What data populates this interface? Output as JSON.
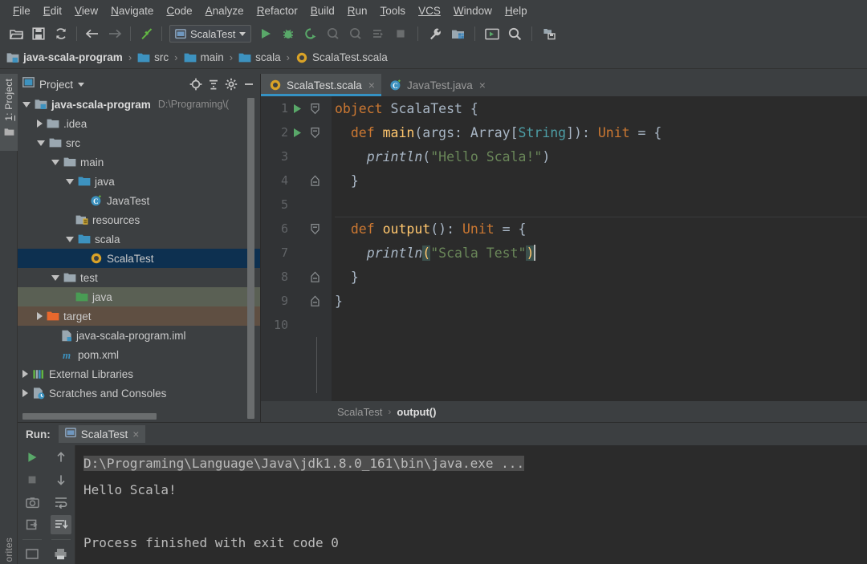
{
  "menubar": {
    "items": [
      {
        "pre": "F",
        "rest": "ile"
      },
      {
        "pre": "E",
        "rest": "dit"
      },
      {
        "pre": "V",
        "rest": "iew"
      },
      {
        "pre": "N",
        "rest": "avigate"
      },
      {
        "pre": "C",
        "rest": "ode"
      },
      {
        "pre": "A",
        "rest": "nalyze"
      },
      {
        "pre": "R",
        "rest": "efactor"
      },
      {
        "pre": "B",
        "rest": "uild"
      },
      {
        "pre": "R",
        "rest": "un"
      },
      {
        "pre": "T",
        "rest": "ools"
      },
      {
        "pre": "VCS",
        "rest": ""
      },
      {
        "pre": "W",
        "rest": "indow"
      },
      {
        "pre": "H",
        "rest": "elp"
      }
    ]
  },
  "toolbar": {
    "icons": [
      "open-folder-icon",
      "save-all-icon",
      "sync-icon",
      "back-arrow-icon",
      "forward-arrow-icon",
      "build-hammer-icon"
    ],
    "run_config": {
      "label": "ScalaTest",
      "icon": "run-config-icon"
    },
    "action_icons": [
      "run-icon",
      "debug-icon",
      "run-with-coverage-icon",
      "profile-icon",
      "profile-alt-icon",
      "rerun-icon",
      "stop-icon",
      "settings-wrench-icon",
      "project-structure-icon",
      "terminal-icon",
      "search-everywhere-icon",
      "update-project-icon"
    ]
  },
  "breadcrumb": {
    "items": [
      {
        "label": "java-scala-program",
        "icon": "module-icon",
        "bold": true
      },
      {
        "label": "src",
        "icon": "folder-icon",
        "bold": false
      },
      {
        "label": "main",
        "icon": "folder-icon",
        "bold": false
      },
      {
        "label": "scala",
        "icon": "folder-icon",
        "bold": false
      },
      {
        "label": "ScalaTest.scala",
        "icon": "scala-object-icon",
        "bold": false
      }
    ],
    "separator": "›"
  },
  "leftbar": {
    "project_tab": {
      "pre": "1",
      "rest": ": Project",
      "icon": "project-tool-icon"
    },
    "favorites_tab": {
      "label": "orites"
    }
  },
  "project_panel": {
    "title": "Project",
    "title_caret": "chevron-down-icon",
    "actions": [
      "locate-target-icon",
      "collapse-all-icon",
      "settings-gear-icon",
      "hide-panel-icon"
    ],
    "tree": [
      {
        "indent": 0,
        "arrow": "down",
        "icon": "module-icon",
        "label": "java-scala-program",
        "bold": true,
        "path": "D:\\Programing\\(",
        "state": "normal"
      },
      {
        "indent": 1,
        "arrow": "right",
        "icon": "folder-icon-gray",
        "label": ".idea",
        "bold": false,
        "path": "",
        "state": "normal"
      },
      {
        "indent": 1,
        "arrow": "down",
        "icon": "folder-icon-gray",
        "label": "src",
        "bold": false,
        "path": "",
        "state": "normal"
      },
      {
        "indent": 2,
        "arrow": "down",
        "icon": "folder-icon-gray",
        "label": "main",
        "bold": false,
        "path": "",
        "state": "normal"
      },
      {
        "indent": 3,
        "arrow": "down",
        "icon": "folder-icon-blue",
        "label": "java",
        "bold": false,
        "path": "",
        "state": "normal"
      },
      {
        "indent": 4,
        "arrow": "none",
        "icon": "java-class-icon",
        "label": "JavaTest",
        "bold": false,
        "path": "",
        "state": "normal"
      },
      {
        "indent": 3,
        "arrow": "none",
        "icon": "resources-icon",
        "label": "resources",
        "bold": false,
        "path": "",
        "state": "normal"
      },
      {
        "indent": 3,
        "arrow": "down",
        "icon": "folder-icon-blue",
        "label": "scala",
        "bold": false,
        "path": "",
        "state": "normal"
      },
      {
        "indent": 4,
        "arrow": "none",
        "icon": "scala-object-icon",
        "label": "ScalaTest",
        "bold": false,
        "path": "",
        "state": "selected"
      },
      {
        "indent": 2,
        "arrow": "down",
        "icon": "folder-icon-gray",
        "label": "test",
        "bold": false,
        "path": "",
        "state": "normal"
      },
      {
        "indent": 3,
        "arrow": "none",
        "icon": "folder-icon-green",
        "label": "java",
        "bold": false,
        "path": "",
        "state": "test-source"
      },
      {
        "indent": 1,
        "arrow": "right",
        "icon": "folder-icon-orange",
        "label": "target",
        "bold": false,
        "path": "",
        "state": "excluded"
      },
      {
        "indent": 2,
        "arrow": "none",
        "icon": "iml-file-icon",
        "label": "java-scala-program.iml",
        "bold": false,
        "path": "",
        "state": "normal"
      },
      {
        "indent": 2,
        "arrow": "none",
        "icon": "maven-pom-icon",
        "label": "pom.xml",
        "bold": false,
        "path": "",
        "state": "normal"
      },
      {
        "indent": 0,
        "arrow": "right",
        "icon": "libraries-icon",
        "label": "External Libraries",
        "bold": false,
        "path": "",
        "state": "normal"
      },
      {
        "indent": 0,
        "arrow": "right",
        "icon": "scratches-icon",
        "label": "Scratches and Consoles",
        "bold": false,
        "path": "",
        "state": "normal"
      }
    ]
  },
  "editor": {
    "tabs": [
      {
        "label": "ScalaTest.scala",
        "icon": "scala-object-icon",
        "active": true,
        "close": "×"
      },
      {
        "label": "JavaTest.java",
        "icon": "java-class-icon",
        "active": false,
        "close": "×"
      }
    ],
    "lines": [
      {
        "no": "1",
        "run": true,
        "fold": "open",
        "sep": false
      },
      {
        "no": "2",
        "run": true,
        "fold": "open",
        "sep": false
      },
      {
        "no": "3",
        "run": false,
        "fold": "none",
        "sep": false
      },
      {
        "no": "4",
        "run": false,
        "fold": "close",
        "sep": false
      },
      {
        "no": "5",
        "run": false,
        "fold": "none",
        "sep": false
      },
      {
        "no": "6",
        "run": false,
        "fold": "open",
        "sep": true
      },
      {
        "no": "7",
        "run": false,
        "fold": "none",
        "sep": false
      },
      {
        "no": "8",
        "run": false,
        "fold": "close",
        "sep": false
      },
      {
        "no": "9",
        "run": false,
        "fold": "close",
        "sep": false
      },
      {
        "no": "10",
        "run": false,
        "fold": "none",
        "sep": false
      }
    ],
    "code": {
      "l1_kw": "object",
      "l1_name": " ScalaTest ",
      "l1_brace": "{",
      "l2_kw": "def",
      "l2_name": " main",
      "l2_p1": "(args: ",
      "l2_t1": "Array",
      "l2_p2": "[",
      "l2_t2": "String",
      "l2_p3": "]): ",
      "l2_t3": "Unit",
      "l2_p4": " = {",
      "l3_fn": "println",
      "l3_p1": "(",
      "l3_str": "\"Hello Scala!\"",
      "l3_p2": ")",
      "l4": "}",
      "l6_kw": "def",
      "l6_name": " output",
      "l6_p1": "(): ",
      "l6_t1": "Unit",
      "l6_p2": " = {",
      "l7_fn": "println",
      "l7_op": "(",
      "l7_str": "\"Scala Test\"",
      "l7_cp": ")",
      "l8": "}",
      "l9": "}"
    },
    "status_breadcrumb": {
      "parent": "ScalaTest",
      "separator": "›",
      "current": "output()"
    }
  },
  "run_panel": {
    "label": "Run:",
    "tab": {
      "label": "ScalaTest",
      "icon": "run-config-icon",
      "close": "×"
    },
    "tools_left": [
      "rerun-icon",
      "stop-icon",
      "screenshot-icon",
      "export-icon"
    ],
    "tools_right": [
      "scroll-up-icon",
      "scroll-down-icon",
      "soft-wrap-icon",
      "scroll-to-end-icon",
      "print-icon"
    ],
    "console_lines": [
      {
        "text": "D:\\Programing\\Language\\Java\\jdk1.8.0_161\\bin\\java.exe ...",
        "highlight": true
      },
      {
        "text": "Hello Scala!",
        "highlight": false
      },
      {
        "text": "",
        "highlight": false
      },
      {
        "text": "Process finished with exit code 0",
        "highlight": false
      }
    ]
  },
  "colors": {
    "panel_bg": "#3c3f41",
    "editor_bg": "#2b2b2b",
    "gutter_bg": "#313335",
    "selection_blue": "#0d3050",
    "test_source_green": "#5a6054",
    "excluded_brown": "#5f4f42",
    "accent_tab": "#3592c4",
    "keyword_orange": "#cc7832",
    "string_green": "#6a8759",
    "method_yellow": "#ffc66d",
    "type_teal": "#4d9ea6",
    "text_default": "#a9b7c6"
  }
}
